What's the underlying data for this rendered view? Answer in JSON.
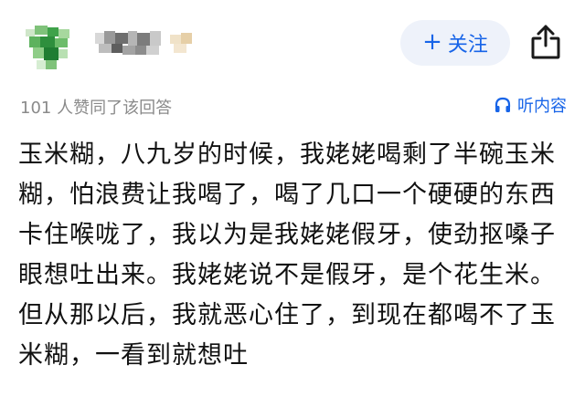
{
  "header": {
    "avatar_icon": "avatar-pixelated",
    "username_icon": "username-pixelated",
    "follow_button": {
      "plus": "+",
      "label": "关注"
    },
    "share_icon": "share-icon"
  },
  "meta": {
    "likes_text": "101 人赞同了该回答",
    "listen_label": "听内容",
    "listen_icon": "headphones-icon"
  },
  "answer": {
    "text": "玉米糊，八九岁的时候，我姥姥喝剩了半碗玉米糊，怕浪费让我喝了，喝了几口一个硬硬的东西卡住喉咙了，我以为是我姥姥假牙，使劲抠嗓子眼想吐出来。我姥姥说不是假牙，是个花生米。但从那以后，我就恶心住了，到现在都喝不了玉米糊，一看到就想吐"
  },
  "colors": {
    "accent": "#1764e8",
    "follow_bg": "#eef2fa",
    "meta_gray": "#8a8a8a"
  }
}
